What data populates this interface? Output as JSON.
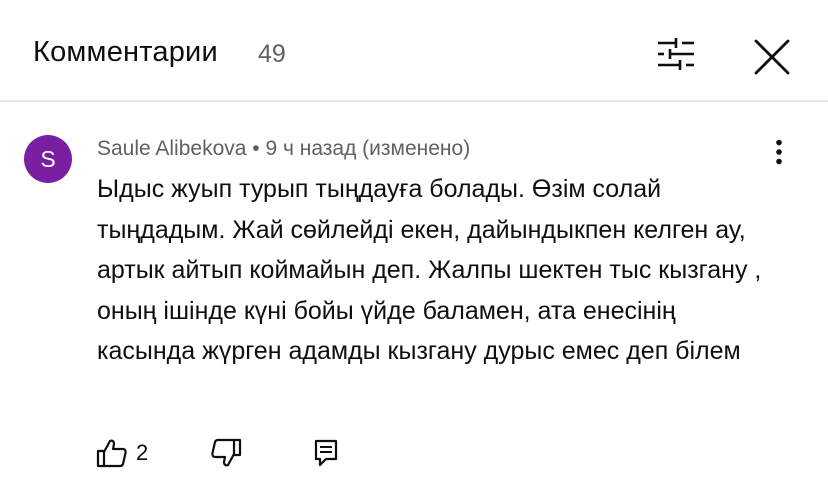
{
  "header": {
    "title": "Комментарии",
    "count": "49"
  },
  "comment": {
    "avatar_letter": "S",
    "avatar_color": "#7b1fa2",
    "meta": "Saule Alibekova • 9 ч назад (изменено)",
    "text": "Ыдыс жуып турып тыңдауға болады. Өзім солай тыңдадым. Жай сөйлейді екен, дайындыкпен келген ау, артык айтып коймайын деп. Жалпы шектен тыс кызгану , оның ішінде күні бойы үйде баламен, ата енесінің касында жүрген адамды кызгану дурыс емес деп білем",
    "likes": "2"
  },
  "icons": {
    "filter": "sliders-icon",
    "close": "close-icon",
    "more": "more-vertical-icon",
    "like": "thumbs-up-icon",
    "dislike": "thumbs-down-icon",
    "reply": "reply-comment-icon"
  }
}
